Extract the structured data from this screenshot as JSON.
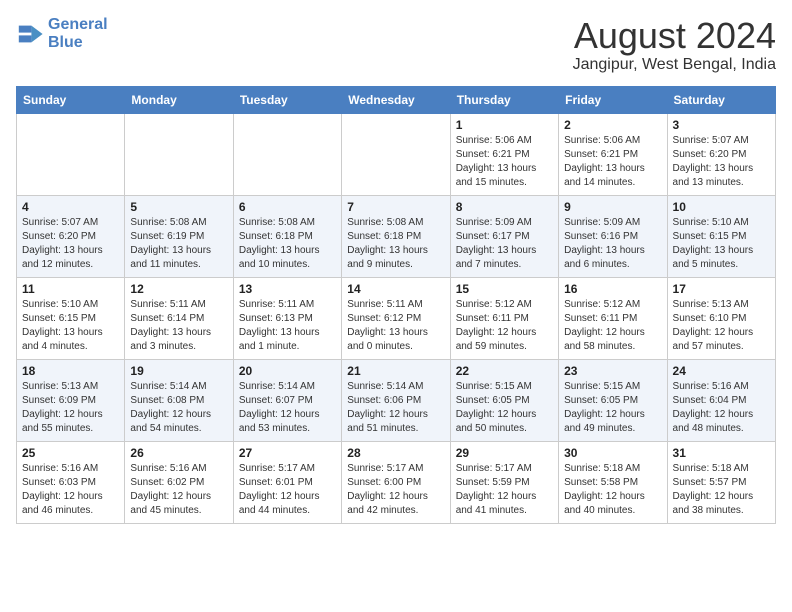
{
  "header": {
    "logo_line1": "General",
    "logo_line2": "Blue",
    "title": "August 2024",
    "subtitle": "Jangipur, West Bengal, India"
  },
  "weekdays": [
    "Sunday",
    "Monday",
    "Tuesday",
    "Wednesday",
    "Thursday",
    "Friday",
    "Saturday"
  ],
  "weeks": [
    [
      {
        "day": "",
        "info": ""
      },
      {
        "day": "",
        "info": ""
      },
      {
        "day": "",
        "info": ""
      },
      {
        "day": "",
        "info": ""
      },
      {
        "day": "1",
        "info": "Sunrise: 5:06 AM\nSunset: 6:21 PM\nDaylight: 13 hours\nand 15 minutes."
      },
      {
        "day": "2",
        "info": "Sunrise: 5:06 AM\nSunset: 6:21 PM\nDaylight: 13 hours\nand 14 minutes."
      },
      {
        "day": "3",
        "info": "Sunrise: 5:07 AM\nSunset: 6:20 PM\nDaylight: 13 hours\nand 13 minutes."
      }
    ],
    [
      {
        "day": "4",
        "info": "Sunrise: 5:07 AM\nSunset: 6:20 PM\nDaylight: 13 hours\nand 12 minutes."
      },
      {
        "day": "5",
        "info": "Sunrise: 5:08 AM\nSunset: 6:19 PM\nDaylight: 13 hours\nand 11 minutes."
      },
      {
        "day": "6",
        "info": "Sunrise: 5:08 AM\nSunset: 6:18 PM\nDaylight: 13 hours\nand 10 minutes."
      },
      {
        "day": "7",
        "info": "Sunrise: 5:08 AM\nSunset: 6:18 PM\nDaylight: 13 hours\nand 9 minutes."
      },
      {
        "day": "8",
        "info": "Sunrise: 5:09 AM\nSunset: 6:17 PM\nDaylight: 13 hours\nand 7 minutes."
      },
      {
        "day": "9",
        "info": "Sunrise: 5:09 AM\nSunset: 6:16 PM\nDaylight: 13 hours\nand 6 minutes."
      },
      {
        "day": "10",
        "info": "Sunrise: 5:10 AM\nSunset: 6:15 PM\nDaylight: 13 hours\nand 5 minutes."
      }
    ],
    [
      {
        "day": "11",
        "info": "Sunrise: 5:10 AM\nSunset: 6:15 PM\nDaylight: 13 hours\nand 4 minutes."
      },
      {
        "day": "12",
        "info": "Sunrise: 5:11 AM\nSunset: 6:14 PM\nDaylight: 13 hours\nand 3 minutes."
      },
      {
        "day": "13",
        "info": "Sunrise: 5:11 AM\nSunset: 6:13 PM\nDaylight: 13 hours\nand 1 minute."
      },
      {
        "day": "14",
        "info": "Sunrise: 5:11 AM\nSunset: 6:12 PM\nDaylight: 13 hours\nand 0 minutes."
      },
      {
        "day": "15",
        "info": "Sunrise: 5:12 AM\nSunset: 6:11 PM\nDaylight: 12 hours\nand 59 minutes."
      },
      {
        "day": "16",
        "info": "Sunrise: 5:12 AM\nSunset: 6:11 PM\nDaylight: 12 hours\nand 58 minutes."
      },
      {
        "day": "17",
        "info": "Sunrise: 5:13 AM\nSunset: 6:10 PM\nDaylight: 12 hours\nand 57 minutes."
      }
    ],
    [
      {
        "day": "18",
        "info": "Sunrise: 5:13 AM\nSunset: 6:09 PM\nDaylight: 12 hours\nand 55 minutes."
      },
      {
        "day": "19",
        "info": "Sunrise: 5:14 AM\nSunset: 6:08 PM\nDaylight: 12 hours\nand 54 minutes."
      },
      {
        "day": "20",
        "info": "Sunrise: 5:14 AM\nSunset: 6:07 PM\nDaylight: 12 hours\nand 53 minutes."
      },
      {
        "day": "21",
        "info": "Sunrise: 5:14 AM\nSunset: 6:06 PM\nDaylight: 12 hours\nand 51 minutes."
      },
      {
        "day": "22",
        "info": "Sunrise: 5:15 AM\nSunset: 6:05 PM\nDaylight: 12 hours\nand 50 minutes."
      },
      {
        "day": "23",
        "info": "Sunrise: 5:15 AM\nSunset: 6:05 PM\nDaylight: 12 hours\nand 49 minutes."
      },
      {
        "day": "24",
        "info": "Sunrise: 5:16 AM\nSunset: 6:04 PM\nDaylight: 12 hours\nand 48 minutes."
      }
    ],
    [
      {
        "day": "25",
        "info": "Sunrise: 5:16 AM\nSunset: 6:03 PM\nDaylight: 12 hours\nand 46 minutes."
      },
      {
        "day": "26",
        "info": "Sunrise: 5:16 AM\nSunset: 6:02 PM\nDaylight: 12 hours\nand 45 minutes."
      },
      {
        "day": "27",
        "info": "Sunrise: 5:17 AM\nSunset: 6:01 PM\nDaylight: 12 hours\nand 44 minutes."
      },
      {
        "day": "28",
        "info": "Sunrise: 5:17 AM\nSunset: 6:00 PM\nDaylight: 12 hours\nand 42 minutes."
      },
      {
        "day": "29",
        "info": "Sunrise: 5:17 AM\nSunset: 5:59 PM\nDaylight: 12 hours\nand 41 minutes."
      },
      {
        "day": "30",
        "info": "Sunrise: 5:18 AM\nSunset: 5:58 PM\nDaylight: 12 hours\nand 40 minutes."
      },
      {
        "day": "31",
        "info": "Sunrise: 5:18 AM\nSunset: 5:57 PM\nDaylight: 12 hours\nand 38 minutes."
      }
    ]
  ]
}
